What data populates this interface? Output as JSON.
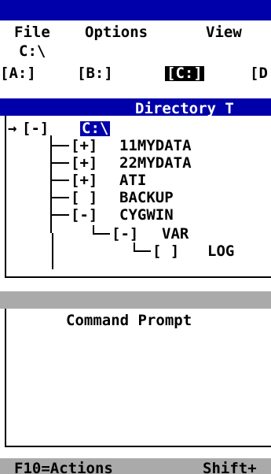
{
  "menu": {
    "file": "File",
    "options": "Options",
    "view": "View"
  },
  "path": "C:\\",
  "drives": [
    "[A:]",
    "[B:]",
    "[C:]",
    "[D"
  ],
  "selected_drive_index": 2,
  "tree": {
    "title": "Directory T",
    "root": {
      "arrow": "→",
      "marker": "[-]",
      "label": "C:\\"
    },
    "items": [
      {
        "marker": "[+]",
        "label": "11MYDATA"
      },
      {
        "marker": "[+]",
        "label": "22MYDATA"
      },
      {
        "marker": "[+]",
        "label": "ATI"
      },
      {
        "marker": "[ ]",
        "label": "BACKUP"
      },
      {
        "marker": "[-]",
        "label": "CYGWIN"
      },
      {
        "marker": "[-]",
        "label": "VAR"
      },
      {
        "marker": "[ ]",
        "label": "LOG"
      }
    ]
  },
  "command_prompt": {
    "title": "Command Prompt"
  },
  "status": {
    "f10": "F10=Actions",
    "shift": "Shift+"
  },
  "colors": {
    "title_bar": "#0000aa",
    "gray": "#aaaaaa"
  }
}
